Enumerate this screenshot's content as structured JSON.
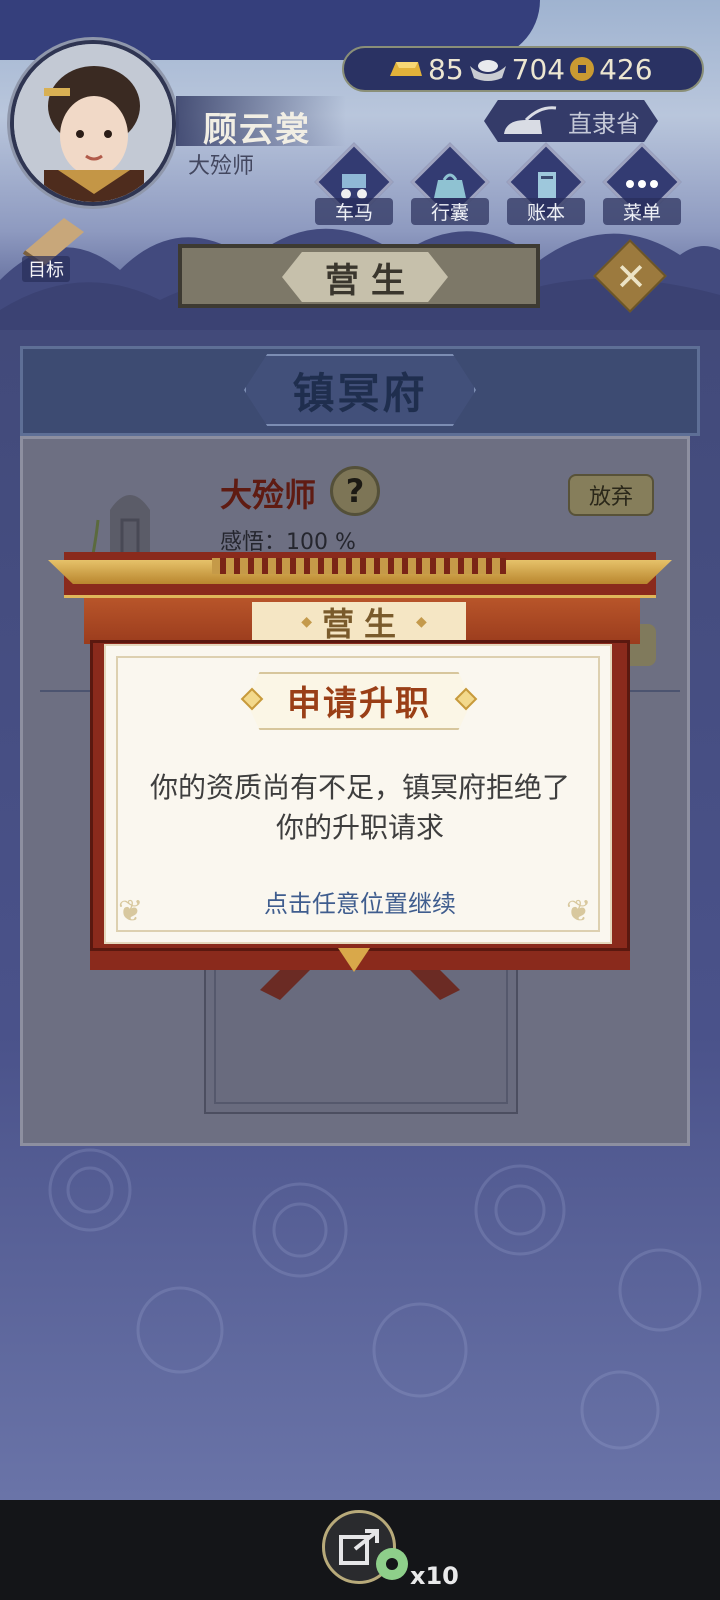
{
  "player": {
    "name": "顾云裳",
    "rank": "大殓师"
  },
  "currency": {
    "gold": "85",
    "silver": "704",
    "coins": "426"
  },
  "province": {
    "label": "直隶省"
  },
  "nav": {
    "items": [
      {
        "label": "车马",
        "icon": "carriage-icon"
      },
      {
        "label": "行囊",
        "icon": "bag-icon"
      },
      {
        "label": "账本",
        "icon": "ledger-icon"
      },
      {
        "label": "菜单",
        "icon": "menu-icon"
      }
    ],
    "goal_label": "目标"
  },
  "page": {
    "title": "营生"
  },
  "org": {
    "name": "镇冥府",
    "rank_name": "大殓师",
    "insight_label": "感悟：",
    "insight_value": "100 %",
    "abandon_label": "放弃",
    "help_symbol": "?"
  },
  "modal": {
    "band_title": "营生",
    "band_dot": "◆",
    "heading": "申请升职",
    "message_line1": "你的资质尚有不足，镇冥府拒绝了",
    "message_line2": "你的升职请求",
    "hint": "点击任意位置继续"
  },
  "share": {
    "count": "x10"
  },
  "colors": {
    "accent_red": "#8a2a1c",
    "heading_brown": "#9a3f17",
    "hint_blue": "#3f5d8e",
    "gold": "#e0b75a"
  }
}
